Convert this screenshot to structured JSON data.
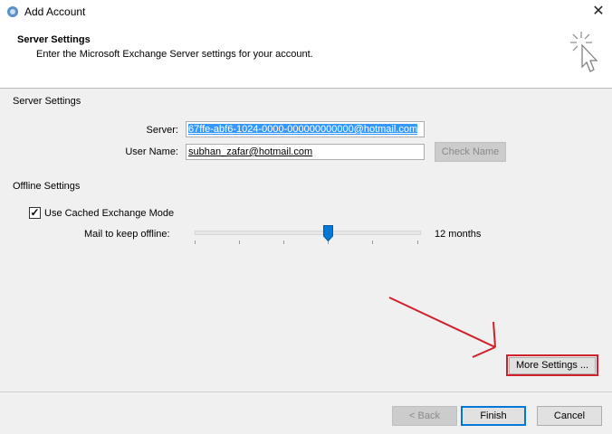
{
  "window": {
    "title": "Add Account",
    "close_glyph": "✕"
  },
  "header": {
    "title": "Server Settings",
    "subtitle": "Enter the Microsoft Exchange Server settings for your account."
  },
  "server_section": {
    "label": "Server Settings",
    "server_label": "Server:",
    "server_value": "67ffe-abf6-1024-0000-000000000000@hotmail.com",
    "username_label": "User Name:",
    "username_value": "subhan_zafar@hotmail.com",
    "check_name_label": "Check Name"
  },
  "offline_section": {
    "label": "Offline Settings",
    "cached_mode_label": "Use Cached Exchange Mode",
    "cached_mode_checked": true,
    "check_glyph": "✓",
    "mail_offline_label": "Mail to keep offline:",
    "mail_offline_value": "12 months"
  },
  "more_settings_label": "More Settings ...",
  "footer": {
    "back_label": "< Back",
    "finish_label": "Finish",
    "cancel_label": "Cancel"
  },
  "colors": {
    "selection": "#3399ff",
    "annotation_red": "#d0202a",
    "accent": "#0078d7"
  },
  "icons": [
    "outlook-app-icon",
    "close-icon",
    "cursor-click-icon",
    "checkbox-check-icon",
    "slider-thumb-icon",
    "annotation-arrow-icon"
  ]
}
